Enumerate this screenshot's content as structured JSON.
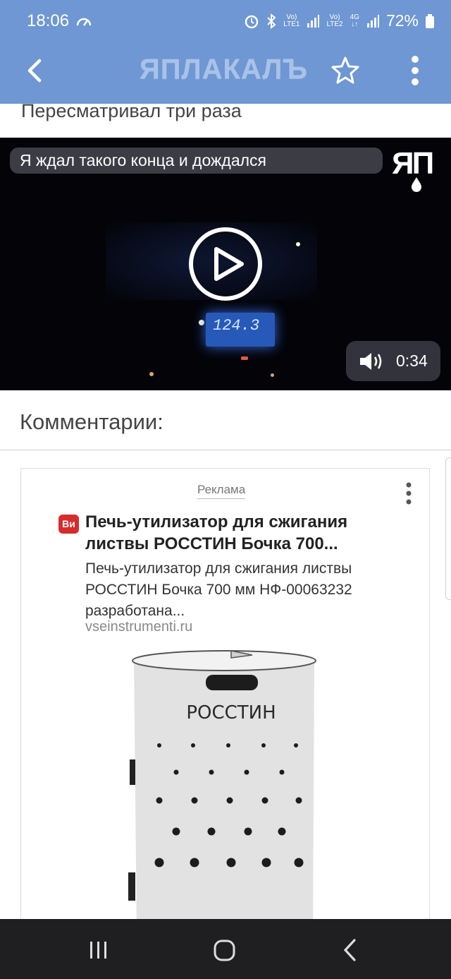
{
  "status_bar": {
    "time": "18:06",
    "sim1_top": "Vo)",
    "sim1_bottom": "LTE1",
    "sim2_top": "Vo)",
    "sim2_bottom": "LTE2",
    "net_type": "4G",
    "battery": "72%"
  },
  "app_bar": {
    "logo": "ЯПЛАКАЛЪ",
    "icons": [
      "back-arrow-icon",
      "star-icon",
      "more-vert-icon"
    ]
  },
  "post": {
    "title": "Пересматривал три раза"
  },
  "video": {
    "caption": "Я ждал такого конца и дождался",
    "watermark": "ЯП",
    "duration": "0:34",
    "dash_display": "124.3"
  },
  "comments": {
    "heading": "Комментарии:"
  },
  "ad": {
    "label": "Реклама",
    "brand_badge": "Ви",
    "headline": "Печь-утилизатор для сжигания листвы РОССТИН Бочка 700...",
    "description": "Печь-утилизатор для сжигания листвы РОССТИН Бочка 700 мм НФ-00063232 разработана...",
    "domain": "vseinstrumenti.ru",
    "product_brand": "РОССТИН",
    "badge_color": "#d62c2c"
  },
  "colors": {
    "app_bar": "#6e97d3",
    "nav_bar": "#1f1f21"
  }
}
